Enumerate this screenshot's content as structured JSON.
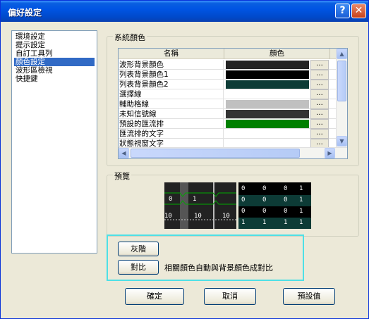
{
  "window": {
    "title": "偏好設定",
    "help_label": "?",
    "close_label": "✕"
  },
  "nav": {
    "items": [
      {
        "label": "環境設定",
        "selected": false
      },
      {
        "label": "提示設定",
        "selected": false
      },
      {
        "label": "自訂工具列",
        "selected": false
      },
      {
        "label": "顏色設定",
        "selected": true
      },
      {
        "label": "波形區檢視",
        "selected": false
      },
      {
        "label": "快捷鍵",
        "selected": false
      }
    ]
  },
  "system_colors": {
    "group_label": "系統顏色",
    "columns": [
      "名稱",
      "顏色"
    ],
    "rows": [
      {
        "name": "波形背景顏色",
        "color": "#222222",
        "dots": "..."
      },
      {
        "name": "列表背景顏色1",
        "color": "#000000",
        "dots": "..."
      },
      {
        "name": "列表背景顏色2",
        "color": "#0d3b36",
        "dots": "..."
      },
      {
        "name": "選擇線",
        "color": "#ffffff",
        "dots": "..."
      },
      {
        "name": "輔助格線",
        "color": "#c0c0c0",
        "dots": "..."
      },
      {
        "name": "未知信號線",
        "color": "#333333",
        "dots": "..."
      },
      {
        "name": "預設的匯流排",
        "color": "#008000",
        "dots": "..."
      },
      {
        "name": "匯流排的文字",
        "color": "#ffffff",
        "dots": "..."
      },
      {
        "name": "狀態視窗文字",
        "color": "#ffffff",
        "dots": "..."
      }
    ],
    "scroll_up": "▲",
    "scroll_down": "▼",
    "scroll_left": "◀",
    "scroll_right": "▶"
  },
  "preview": {
    "group_label": "預覽",
    "left_labels": {
      "zero": "0",
      "one": "1",
      "ten_a": "10",
      "ten_b": "10",
      "ten_c": "10"
    },
    "bits": [
      [
        "0",
        "0",
        "0",
        "1"
      ],
      [
        "0",
        "0",
        "0",
        "1"
      ],
      [
        "0",
        "0",
        "0",
        "1"
      ],
      [
        "1",
        "1",
        "1",
        "1"
      ]
    ],
    "row_colors": [
      "#000000",
      "#0d3b36",
      "#000000",
      "#0d3b36"
    ]
  },
  "actions": {
    "grayscale_label": "灰階",
    "contrast_label": "對比",
    "contrast_desc": "相關顏色自動與背景顏色成對比"
  },
  "footer": {
    "ok_label": "確定",
    "cancel_label": "取消",
    "default_label": "預設值"
  }
}
